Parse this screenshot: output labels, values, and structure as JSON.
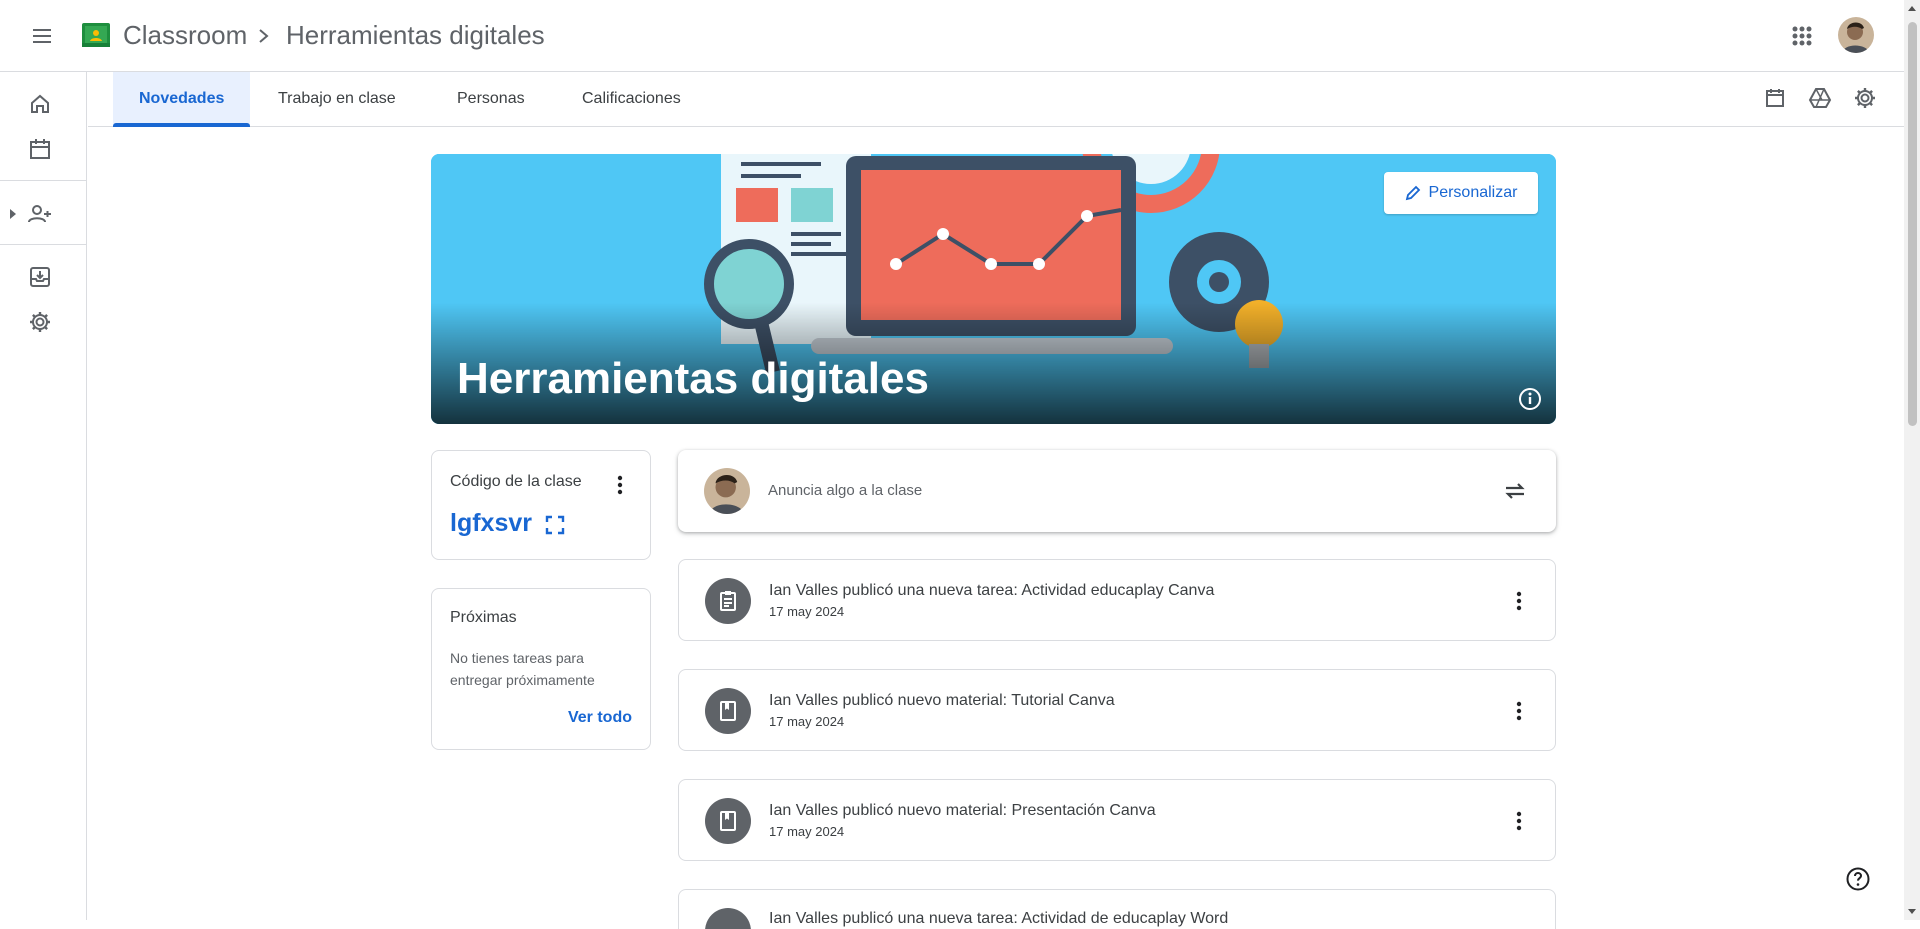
{
  "header": {
    "menu_icon": "hamburger-menu-icon",
    "app_name": "Classroom",
    "breadcrumb_separator_icon": "chevron-right-icon",
    "class_name": "Herramientas digitales",
    "apps_icon": "google-apps-grid-icon",
    "account_avatar": "user-avatar"
  },
  "sidebar": {
    "items": [
      {
        "name": "home",
        "icon": "home-icon"
      },
      {
        "name": "calendar",
        "icon": "calendar-icon"
      },
      {
        "name": "enrolled",
        "icon": "people-icon"
      },
      {
        "name": "archived",
        "icon": "archive-icon"
      },
      {
        "name": "settings",
        "icon": "settings-gear-icon"
      }
    ]
  },
  "tabs": [
    {
      "label": "Novedades",
      "active": true
    },
    {
      "label": "Trabajo en clase",
      "active": false
    },
    {
      "label": "Personas",
      "active": false
    },
    {
      "label": "Calificaciones",
      "active": false
    }
  ],
  "tab_tools": [
    "calendar-icon",
    "drive-icon",
    "settings-gear-icon"
  ],
  "banner": {
    "title": "Herramientas digitales",
    "personalize_label": "Personalizar",
    "colors": {
      "background": "#4fc7f5",
      "accent": "#ee6c5b"
    }
  },
  "class_code": {
    "title": "Código de la clase",
    "code": "lgfxsvr"
  },
  "upcoming": {
    "title": "Próximas",
    "text": "No tienes tareas para entregar próximamente",
    "see_all": "Ver todo"
  },
  "announce": {
    "placeholder": "Anuncia algo a la clase"
  },
  "posts": [
    {
      "title": "Ian Valles publicó una nueva tarea: Actividad educaplay Canva",
      "date": "17 may 2024",
      "icon": "assignment-icon"
    },
    {
      "title": "Ian Valles publicó nuevo material: Tutorial Canva",
      "date": "17 may 2024",
      "icon": "material-book-icon"
    },
    {
      "title": "Ian Valles publicó nuevo material: Presentación Canva",
      "date": "17 may 2024",
      "icon": "material-book-icon"
    },
    {
      "title": "Ian Valles publicó una nueva tarea: Actividad de educaplay Word",
      "date": "",
      "icon": "assignment-icon"
    }
  ],
  "colors": {
    "brand_blue": "#1967d2",
    "divider": "#dadce0",
    "text": "#3c4043"
  }
}
